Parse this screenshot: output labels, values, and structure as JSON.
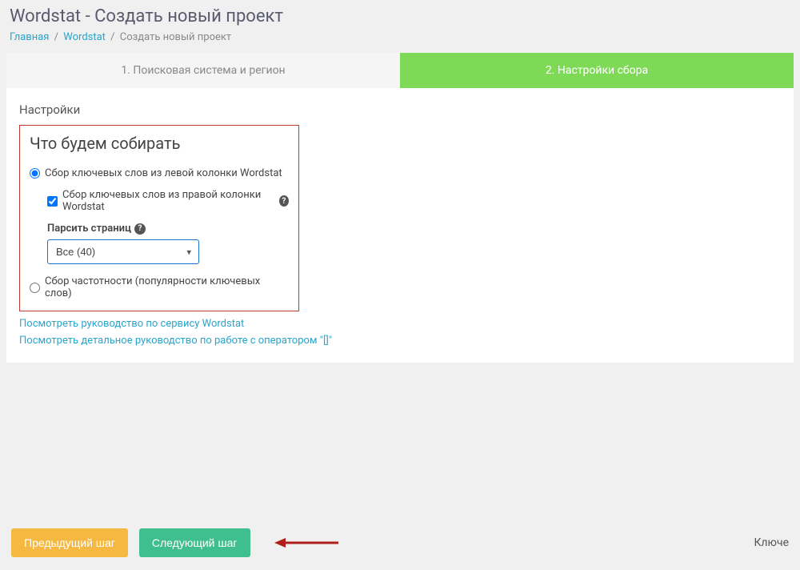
{
  "title": "Wordstat - Создать новый проект",
  "breadcrumb": {
    "home": "Главная",
    "wordstat": "Wordstat",
    "current": "Создать новый проект"
  },
  "steps": {
    "step1": "1. Поисковая система и регион",
    "step2": "2. Настройки сбора"
  },
  "settings_label": "Настройки",
  "config": {
    "heading": "Что будем собирать",
    "radio_left": "Сбор ключевых слов из левой колонки Wordstat",
    "check_right": "Сбор ключевых слов из правой колонки Wordstat",
    "parse_label": "Парсить страниц",
    "select_value": "Все (40)",
    "radio_freq": "Сбор частотности (популярности ключевых слов)"
  },
  "links": {
    "guide": "Посмотреть руководство по сервису Wordstat",
    "detail": "Посмотреть детальное руководство по работе с оператором \"[]\""
  },
  "buttons": {
    "prev": "Предыдущий шаг",
    "next": "Следующий шаг"
  },
  "footer_right": "Ключе"
}
